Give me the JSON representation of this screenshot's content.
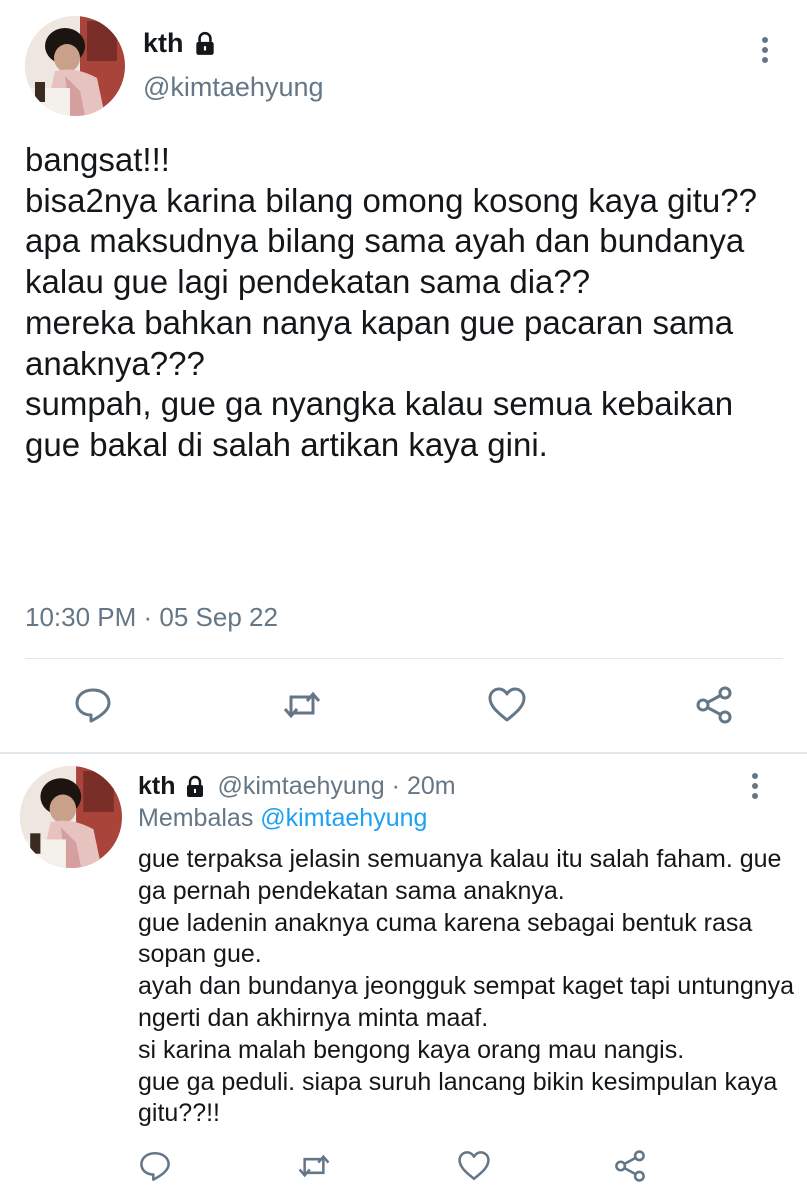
{
  "main_tweet": {
    "name": "kth",
    "handle": "@kimtaehyung",
    "text": "bangsat!!!\nbisa2nya karina bilang omong kosong kaya gitu??\napa maksudnya bilang sama ayah dan bundanya kalau gue lagi pendekatan sama dia??\nmereka bahkan nanya kapan gue pacaran sama anaknya???\nsumpah, gue ga nyangka kalau semua kebaikan gue bakal di salah artikan kaya gini.",
    "meta": "10:30 PM · 05 Sep 22",
    "icons": [
      "lock-icon",
      "more-icon",
      "reply-icon",
      "retweet-icon",
      "like-icon",
      "share-icon"
    ]
  },
  "reply_tweet": {
    "name": "kth",
    "handle": "@kimtaehyung",
    "dot": "·",
    "time": "20m",
    "replying_prefix": "Membalas",
    "replying_to": "@kimtaehyung",
    "text": "gue terpaksa jelasin semuanya kalau itu salah faham. gue ga pernah pendekatan sama anaknya.\ngue ladenin anaknya cuma karena sebagai bentuk rasa sopan gue.\nayah dan bundanya jeongguk sempat kaget tapi untungnya ngerti dan akhirnya minta maaf.\nsi karina malah bengong kaya orang mau nangis.\ngue ga peduli. siapa suruh lancang bikin kesimpulan kaya gitu??!!",
    "icons": [
      "lock-icon",
      "more-icon",
      "reply-icon",
      "retweet-icon",
      "like-icon",
      "share-icon"
    ]
  },
  "colors": {
    "text": "#14171a",
    "secondary": "#657786",
    "link": "#1da1f2",
    "divider": "#e1e8ed",
    "background": "#ffffff"
  }
}
